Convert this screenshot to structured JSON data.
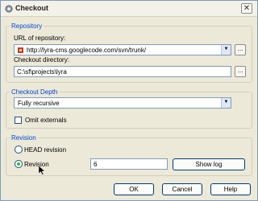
{
  "window": {
    "title": "Checkout",
    "close_glyph": "✕"
  },
  "repository": {
    "group_label": "Repository",
    "url_label": "URL of repository:",
    "url_value": "http://lyra-cms.googlecode.com/svn/trunk/",
    "dir_label": "Checkout directory:",
    "dir_value": "C:\\sf\\projects\\lyra",
    "browse_label": "..."
  },
  "depth": {
    "group_label": "Checkout Depth",
    "selected": "Fully recursive",
    "omit_externals_label": "Omit externals",
    "omit_externals_checked": false
  },
  "revision": {
    "group_label": "Revision",
    "head_label": "HEAD revision",
    "revision_label": "Revision",
    "revision_value": "6",
    "show_log_label": "Show log",
    "selected_option": "revision"
  },
  "buttons": {
    "ok": "OK",
    "cancel": "Cancel",
    "help": "Help"
  },
  "icons": {
    "title": "checkout-icon",
    "url": "repository-icon",
    "dropdown": "chevron-down-icon",
    "cursor": "mouse-pointer-icon"
  }
}
